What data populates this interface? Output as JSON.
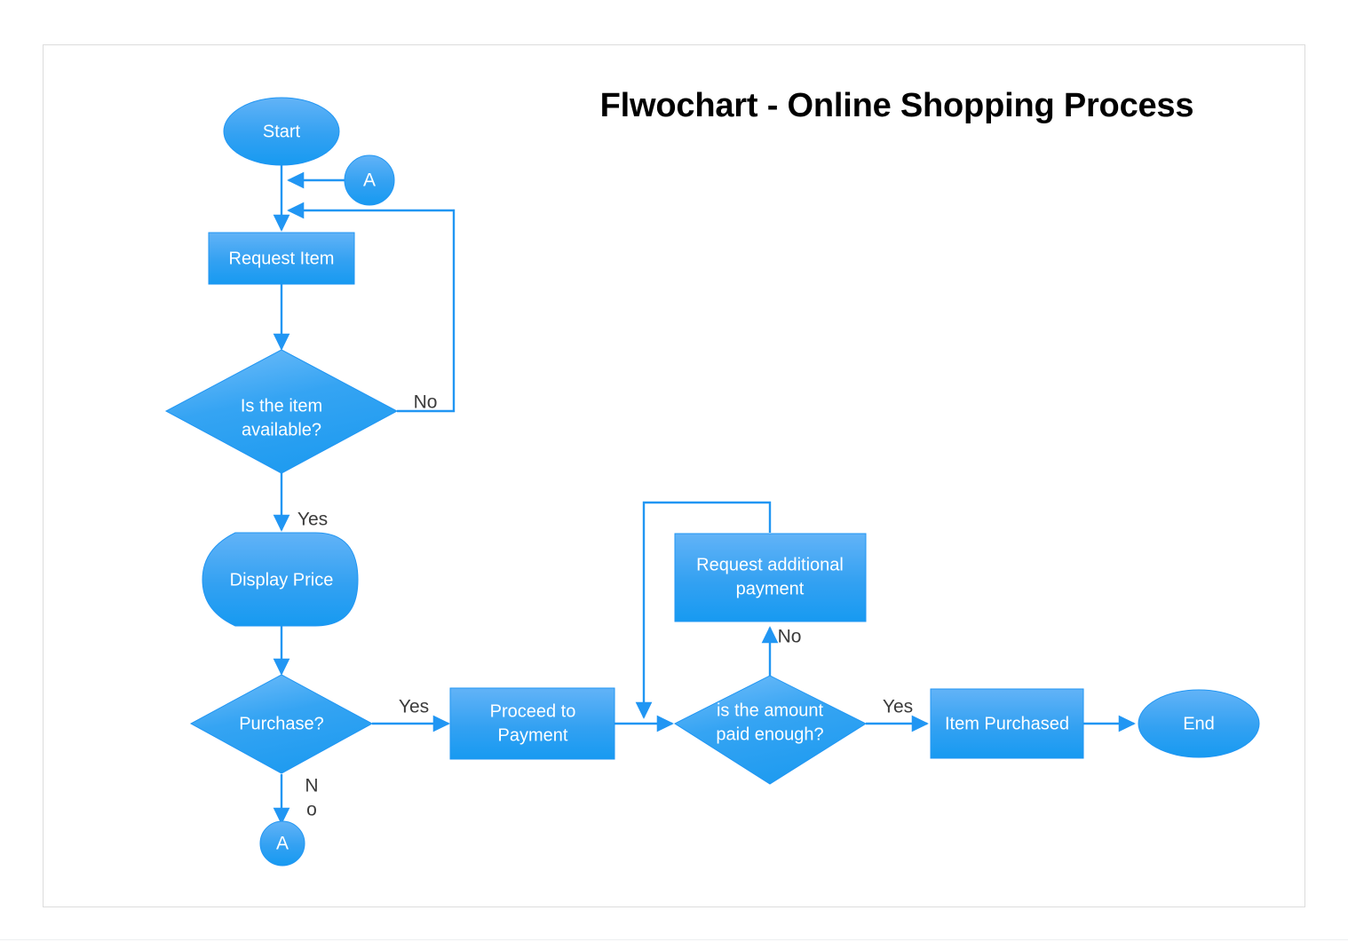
{
  "title": "Flwochart - Online Shopping Process",
  "colors": {
    "shape_fill_top": "#56ACF6",
    "shape_fill_bottom": "#1E9BF0",
    "shape_stroke": "#2196F3",
    "connector": "#2196F3",
    "label_text": "#3b3b3b",
    "node_text": "#ffffff",
    "page_border": "#dcdcdc",
    "background": "#ffffff"
  },
  "chart_data": {
    "type": "diagram",
    "title": "Flwochart - Online Shopping Process",
    "nodes": [
      {
        "id": "start",
        "label": "Start",
        "shape": "ellipse"
      },
      {
        "id": "connector_a_top",
        "label": "A",
        "shape": "circle"
      },
      {
        "id": "request_item",
        "label": "Request Item",
        "shape": "rectangle"
      },
      {
        "id": "item_available",
        "label": "Is the item available?",
        "shape": "diamond"
      },
      {
        "id": "display_price",
        "label": "Display Price",
        "shape": "display"
      },
      {
        "id": "purchase",
        "label": "Purchase?",
        "shape": "diamond"
      },
      {
        "id": "connector_a_bottom",
        "label": "A",
        "shape": "circle"
      },
      {
        "id": "proceed_payment",
        "label": "Proceed to Payment",
        "shape": "rectangle"
      },
      {
        "id": "request_additional_payment",
        "label": "Request additional payment",
        "shape": "rectangle"
      },
      {
        "id": "amount_paid_enough",
        "label": "is the amount paid enough?",
        "shape": "diamond"
      },
      {
        "id": "item_purchased",
        "label": "Item Purchased",
        "shape": "rectangle"
      },
      {
        "id": "end",
        "label": "End",
        "shape": "ellipse"
      }
    ],
    "edges": [
      {
        "from": "start",
        "to": "request_item",
        "label": ""
      },
      {
        "from": "connector_a_top",
        "to": "request_item",
        "label": ""
      },
      {
        "from": "request_item",
        "to": "item_available",
        "label": ""
      },
      {
        "from": "item_available",
        "to": "request_item",
        "label": "No"
      },
      {
        "from": "item_available",
        "to": "display_price",
        "label": "Yes"
      },
      {
        "from": "display_price",
        "to": "purchase",
        "label": ""
      },
      {
        "from": "purchase",
        "to": "proceed_payment",
        "label": "Yes"
      },
      {
        "from": "purchase",
        "to": "connector_a_bottom",
        "label": "No"
      },
      {
        "from": "proceed_payment",
        "to": "amount_paid_enough",
        "label": ""
      },
      {
        "from": "amount_paid_enough",
        "to": "request_additional_payment",
        "label": "No"
      },
      {
        "from": "request_additional_payment",
        "to": "amount_paid_enough",
        "label": ""
      },
      {
        "from": "amount_paid_enough",
        "to": "item_purchased",
        "label": "Yes"
      },
      {
        "from": "item_purchased",
        "to": "end",
        "label": ""
      }
    ]
  },
  "nodes": {
    "start": {
      "label": "Start"
    },
    "connector_a_top": {
      "label": "A"
    },
    "request_item": {
      "label": "Request Item"
    },
    "item_available": {
      "line1": "Is the item",
      "line2": "available?"
    },
    "display_price": {
      "label": "Display Price"
    },
    "purchase": {
      "label": "Purchase?"
    },
    "connector_a_bottom": {
      "label": "A"
    },
    "proceed_payment": {
      "line1": "Proceed to",
      "line2": "Payment"
    },
    "request_additional_payment": {
      "line1": "Request additional",
      "line2": "payment"
    },
    "amount_paid_enough": {
      "line1": "is the amount",
      "line2": "paid enough?"
    },
    "item_purchased": {
      "label": "Item Purchased"
    },
    "end": {
      "label": "End"
    }
  },
  "edge_labels": {
    "available_no": "No",
    "available_yes": "Yes",
    "purchase_yes": "Yes",
    "purchase_no_line1": "N",
    "purchase_no_line2": "o",
    "payment_no": "No",
    "payment_yes": "Yes"
  }
}
